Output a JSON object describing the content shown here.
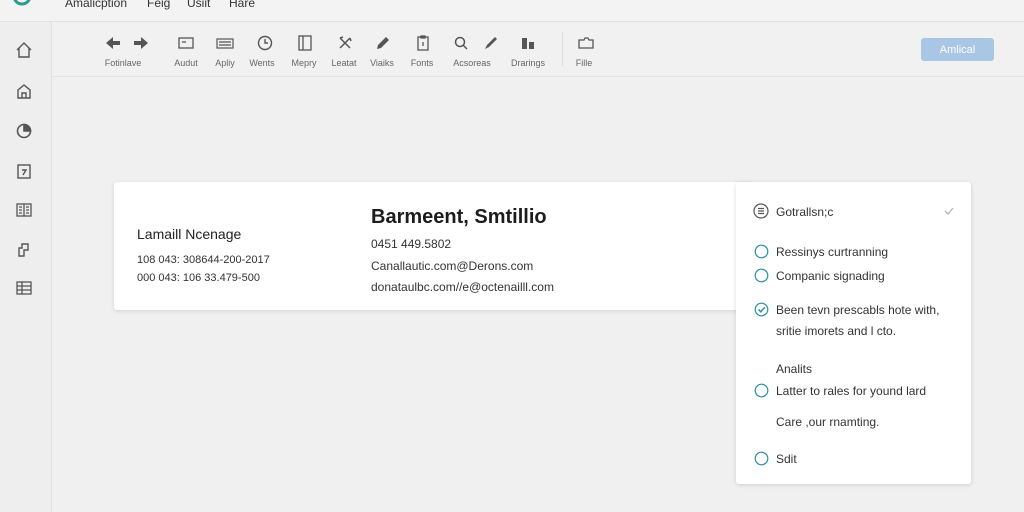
{
  "menubar": {
    "items": [
      "Amalicption",
      "Feig",
      "Usiit",
      "Hare"
    ]
  },
  "sidebar": {
    "items": [
      {
        "icon": "home-icon"
      },
      {
        "icon": "house-icon"
      },
      {
        "icon": "chart-icon"
      },
      {
        "icon": "calendar-icon"
      },
      {
        "icon": "book-icon"
      },
      {
        "icon": "puzzle-icon"
      },
      {
        "icon": "table-icon"
      }
    ]
  },
  "toolbar": {
    "items": [
      {
        "label": "Fotinlave",
        "icon": "back-forward-icon"
      },
      {
        "label": "Audut",
        "icon": "window-icon"
      },
      {
        "label": "Apliy",
        "icon": "keyboard-icon"
      },
      {
        "label": "Wents",
        "icon": "clock-icon"
      },
      {
        "label": "Mepry",
        "icon": "document-icon"
      },
      {
        "label": "Leatat",
        "icon": "tools-icon"
      },
      {
        "label": "Viaiks",
        "icon": "pencil-icon"
      },
      {
        "label": "Fonts",
        "icon": "clipboard-icon"
      },
      {
        "label": "Acsoreas",
        "icon": "search-icon"
      },
      {
        "label": "Drarings",
        "icon": "pen-icon"
      },
      {
        "label": "Fille",
        "icon": "folder-icon"
      }
    ],
    "primary_button": "Amlical",
    "accent_color": "#a9c7e4"
  },
  "contact": {
    "left_name": "Lamaill Ncenage",
    "left_numbers": [
      "108 043: 308644-200-2017",
      "000 043: 106 33.479-500"
    ],
    "name": "Barmeent, Smtillio",
    "details": [
      "0451 449.5802",
      "Canallautic.com@Derons.com",
      "donataulbc.com//e@octenailll.com"
    ]
  },
  "panel": {
    "title": "Gotrallsn;c",
    "options": [
      {
        "label": "Ressinys curtranning",
        "checked": false
      },
      {
        "label": "Companic signading",
        "checked": false
      },
      {
        "label": "Been tevn prescabls hote with,",
        "checked": true
      }
    ],
    "option_continuation": "sritie imorets and l cto.",
    "section_label": "Analits",
    "option_later": {
      "label": "Latter to rales for yound lard",
      "checked": false
    },
    "note_text": "Care ,our rnamting.",
    "submit_label": "Sdit",
    "check_color": "#2a8fa0"
  }
}
